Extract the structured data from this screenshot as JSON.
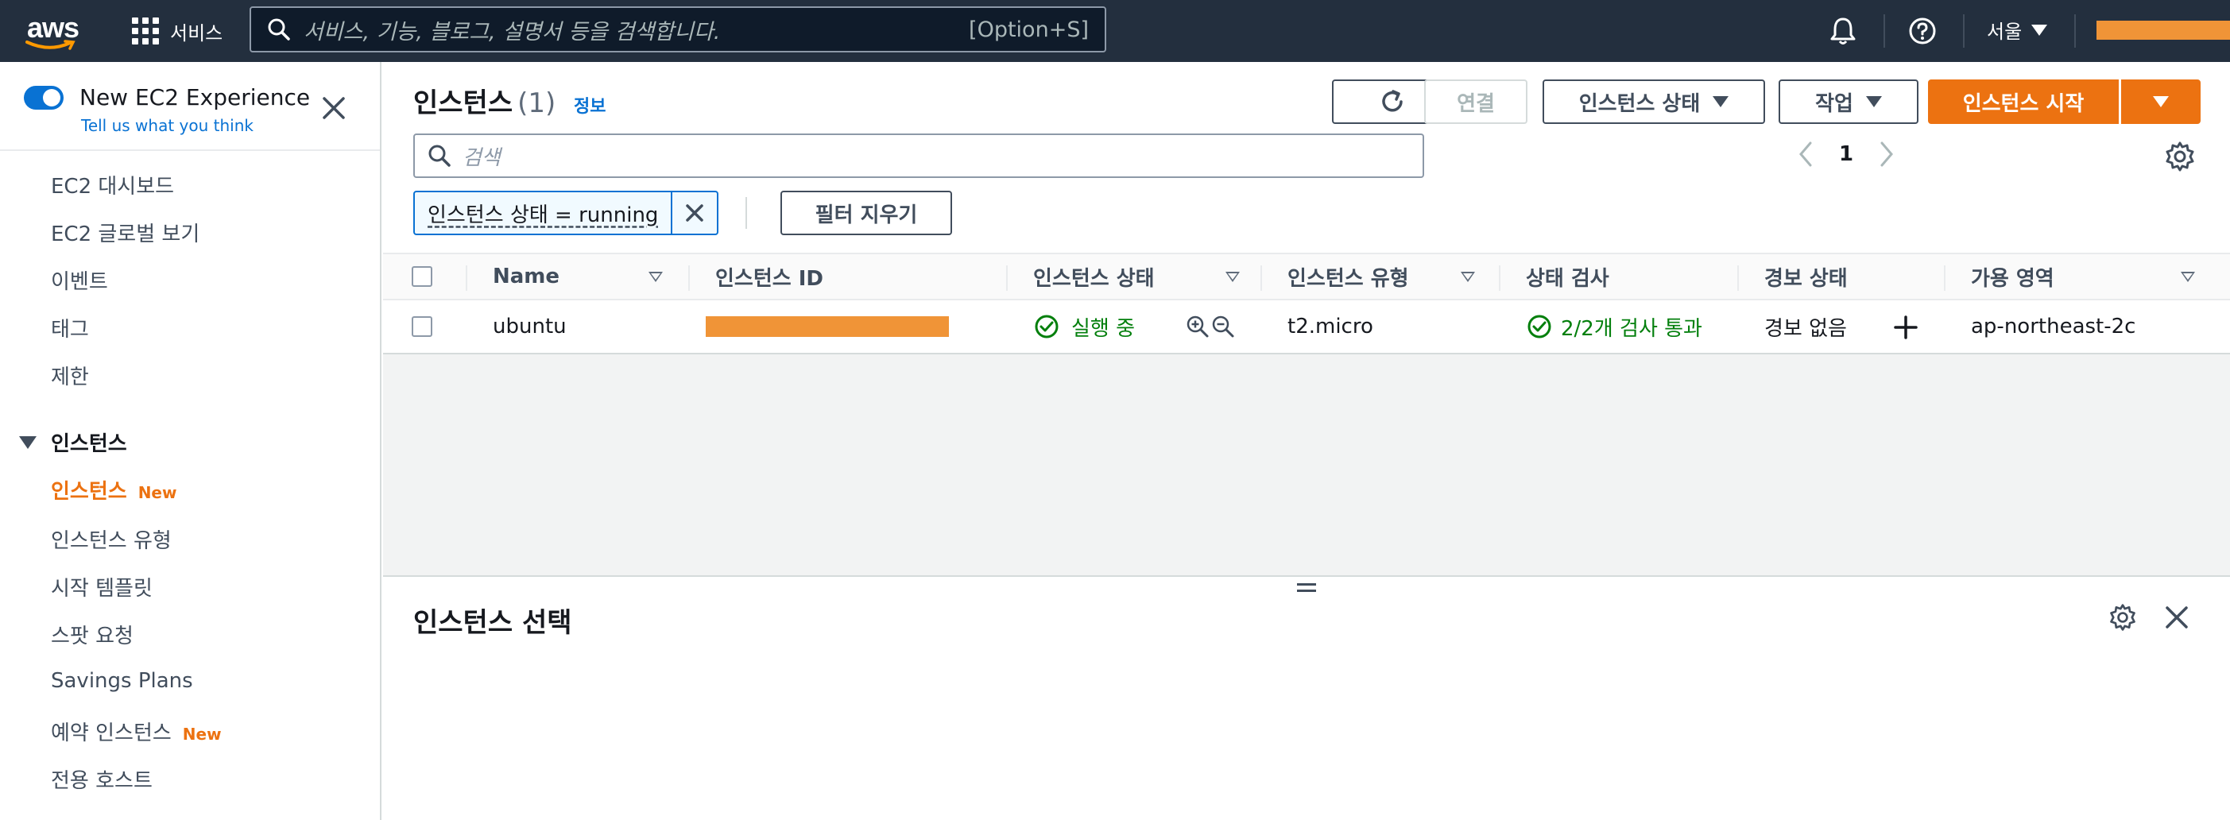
{
  "topnav": {
    "logo_text": "aws",
    "services_label": "서비스",
    "search_placeholder": "서비스, 기능, 블로그, 설명서 등을 검색합니다.",
    "search_shortcut": "[Option+S]",
    "region_label": "서울"
  },
  "sidebar": {
    "experience_label": "New EC2 Experience",
    "experience_feedback": "Tell us what you think",
    "items": [
      {
        "label": "EC2 대시보드"
      },
      {
        "label": "EC2 글로벌 보기"
      },
      {
        "label": "이벤트"
      },
      {
        "label": "태그"
      },
      {
        "label": "제한"
      }
    ],
    "section_instances": "인스턴스",
    "instance_items": [
      {
        "label": "인스턴스",
        "badge": "New",
        "active": true
      },
      {
        "label": "인스턴스 유형"
      },
      {
        "label": "시작 템플릿"
      },
      {
        "label": "스팟 요청"
      },
      {
        "label": "Savings Plans"
      },
      {
        "label": "예약 인스턴스",
        "badge": "New"
      },
      {
        "label": "전용 호스트"
      }
    ]
  },
  "main": {
    "title": "인스턴스",
    "count": "(1)",
    "info_link": "정보",
    "buttons": {
      "connect": "연결",
      "instance_state": "인스턴스 상태",
      "actions": "작업",
      "launch": "인스턴스 시작"
    },
    "search_placeholder": "검색",
    "page_number": "1",
    "filter_token": "인스턴스 상태 = running",
    "clear_filters": "필터 지우기",
    "table": {
      "headers": [
        "Name",
        "인스턴스 ID",
        "인스턴스 상태",
        "인스턴스 유형",
        "상태 검사",
        "경보 상태",
        "가용 영역"
      ],
      "rows": [
        {
          "name": "ubuntu",
          "instance_id": "",
          "state": "실행 중",
          "type": "t2.micro",
          "status_check": "2/2개 검사 통과",
          "alarm": "경보 없음",
          "az": "ap-northeast-2c"
        }
      ]
    },
    "detail_title": "인스턴스 선택"
  },
  "colors": {
    "nav_bg": "#232f3e",
    "primary": "#ec7211",
    "link": "#0972d3",
    "success": "#037f0c"
  }
}
